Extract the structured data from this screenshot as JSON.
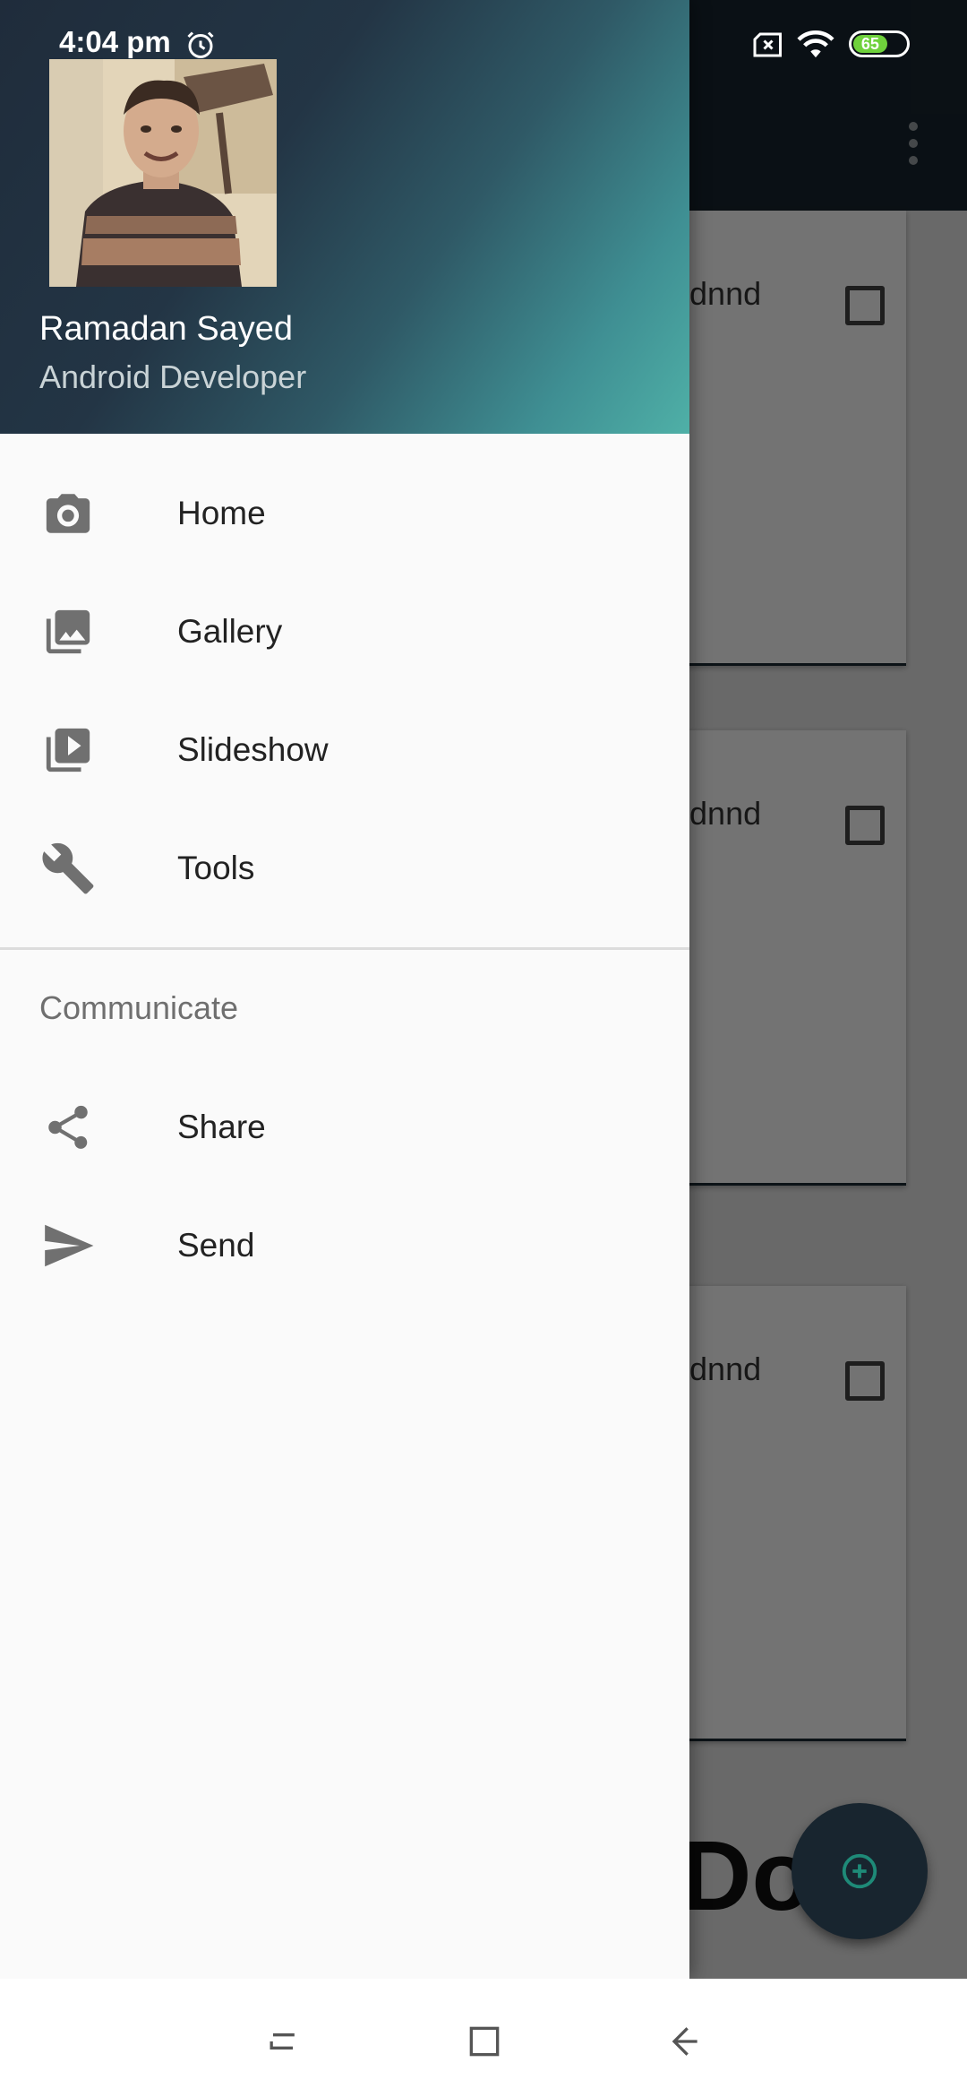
{
  "status_bar": {
    "time": "4:04 pm",
    "battery_level": "65"
  },
  "background": {
    "cards": [
      {
        "text": "ndmdnnd"
      },
      {
        "text": "ndmdnnd"
      },
      {
        "text": "ndmdnnd"
      }
    ],
    "big_text": "Do"
  },
  "drawer": {
    "header": {
      "user_name": "Ramadan Sayed",
      "user_role": "Android Developer"
    },
    "items": [
      {
        "label": "Home",
        "icon": "camera-icon"
      },
      {
        "label": "Gallery",
        "icon": "gallery-icon"
      },
      {
        "label": "Slideshow",
        "icon": "slideshow-icon"
      },
      {
        "label": "Tools",
        "icon": "wrench-icon"
      }
    ],
    "section_title": "Communicate",
    "section_items": [
      {
        "label": "Share",
        "icon": "share-icon"
      },
      {
        "label": "Send",
        "icon": "send-icon"
      }
    ]
  },
  "colors": {
    "toolbar": "#18252f",
    "header_gradient_start": "#1f2c3b",
    "header_gradient_end": "#4fb0a7",
    "battery": "#6fd13c",
    "fab_icon": "#1e8a78"
  }
}
